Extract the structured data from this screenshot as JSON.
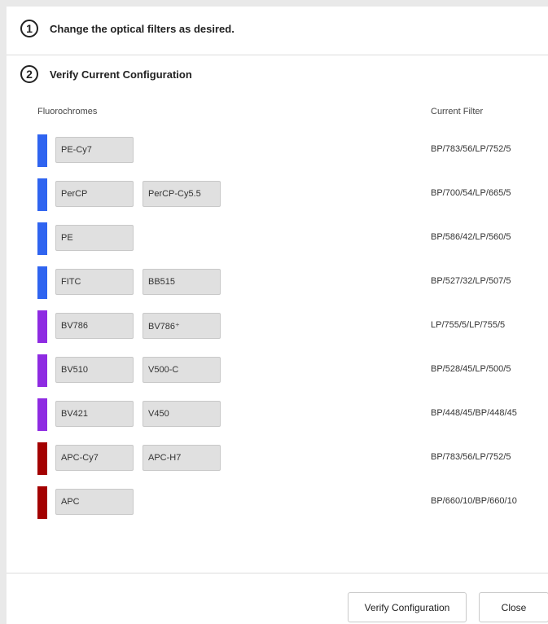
{
  "steps": [
    {
      "number": "1",
      "title": "Change the optical filters as desired."
    },
    {
      "number": "2",
      "title": "Verify Current Configuration"
    }
  ],
  "table": {
    "headers": {
      "fluorochromes": "Fluorochromes",
      "current_filter": "Current Filter"
    },
    "rows": [
      {
        "color": "#2f64f0",
        "fluorochromes": [
          "PE-Cy7"
        ],
        "filter": "BP/783/56/LP/752/5"
      },
      {
        "color": "#2f64f0",
        "fluorochromes": [
          "PerCP",
          "PerCP-Cy5.5"
        ],
        "filter": "BP/700/54/LP/665/5"
      },
      {
        "color": "#2f64f0",
        "fluorochromes": [
          "PE"
        ],
        "filter": "BP/586/42/LP/560/5"
      },
      {
        "color": "#2f64f0",
        "fluorochromes": [
          "FITC",
          "BB515"
        ],
        "filter": "BP/527/32/LP/507/5"
      },
      {
        "color": "#8e2be2",
        "fluorochromes": [
          "BV786",
          "BV786⁺"
        ],
        "filter": "LP/755/5/LP/755/5"
      },
      {
        "color": "#8e2be2",
        "fluorochromes": [
          "BV510",
          "V500-C"
        ],
        "filter": "BP/528/45/LP/500/5"
      },
      {
        "color": "#8e2be2",
        "fluorochromes": [
          "BV421",
          "V450"
        ],
        "filter": "BP/448/45/BP/448/45"
      },
      {
        "color": "#a30000",
        "fluorochromes": [
          "APC-Cy7",
          "APC-H7"
        ],
        "filter": "BP/783/56/LP/752/5"
      },
      {
        "color": "#a30000",
        "fluorochromes": [
          "APC"
        ],
        "filter": "BP/660/10/BP/660/10"
      }
    ]
  },
  "footer": {
    "verify_label": "Verify Configuration",
    "close_label": "Close"
  }
}
